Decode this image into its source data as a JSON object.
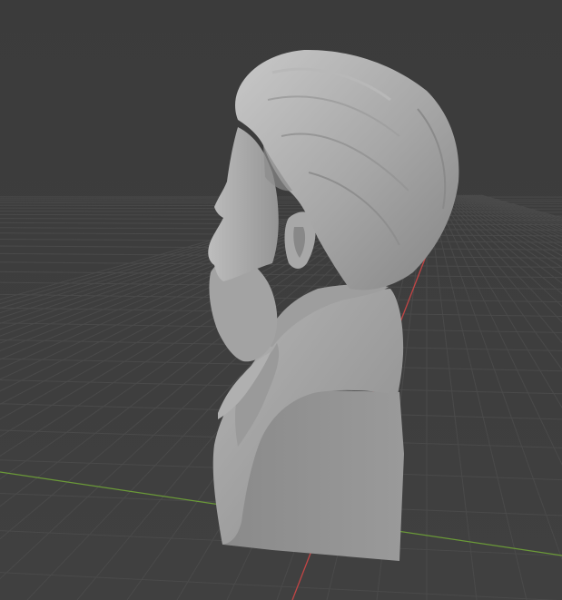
{
  "viewport": {
    "background_color": "#3d3d3d",
    "grid_color": "#4a4a4a",
    "x_axis_color": "#c44848",
    "y_axis_color": "#6f9a3a"
  },
  "model": {
    "name": "bust-sculpt",
    "base_color": "#a4a4a4",
    "shadow_color": "#6f6f6f",
    "highlight_color": "#c2c2c2"
  }
}
